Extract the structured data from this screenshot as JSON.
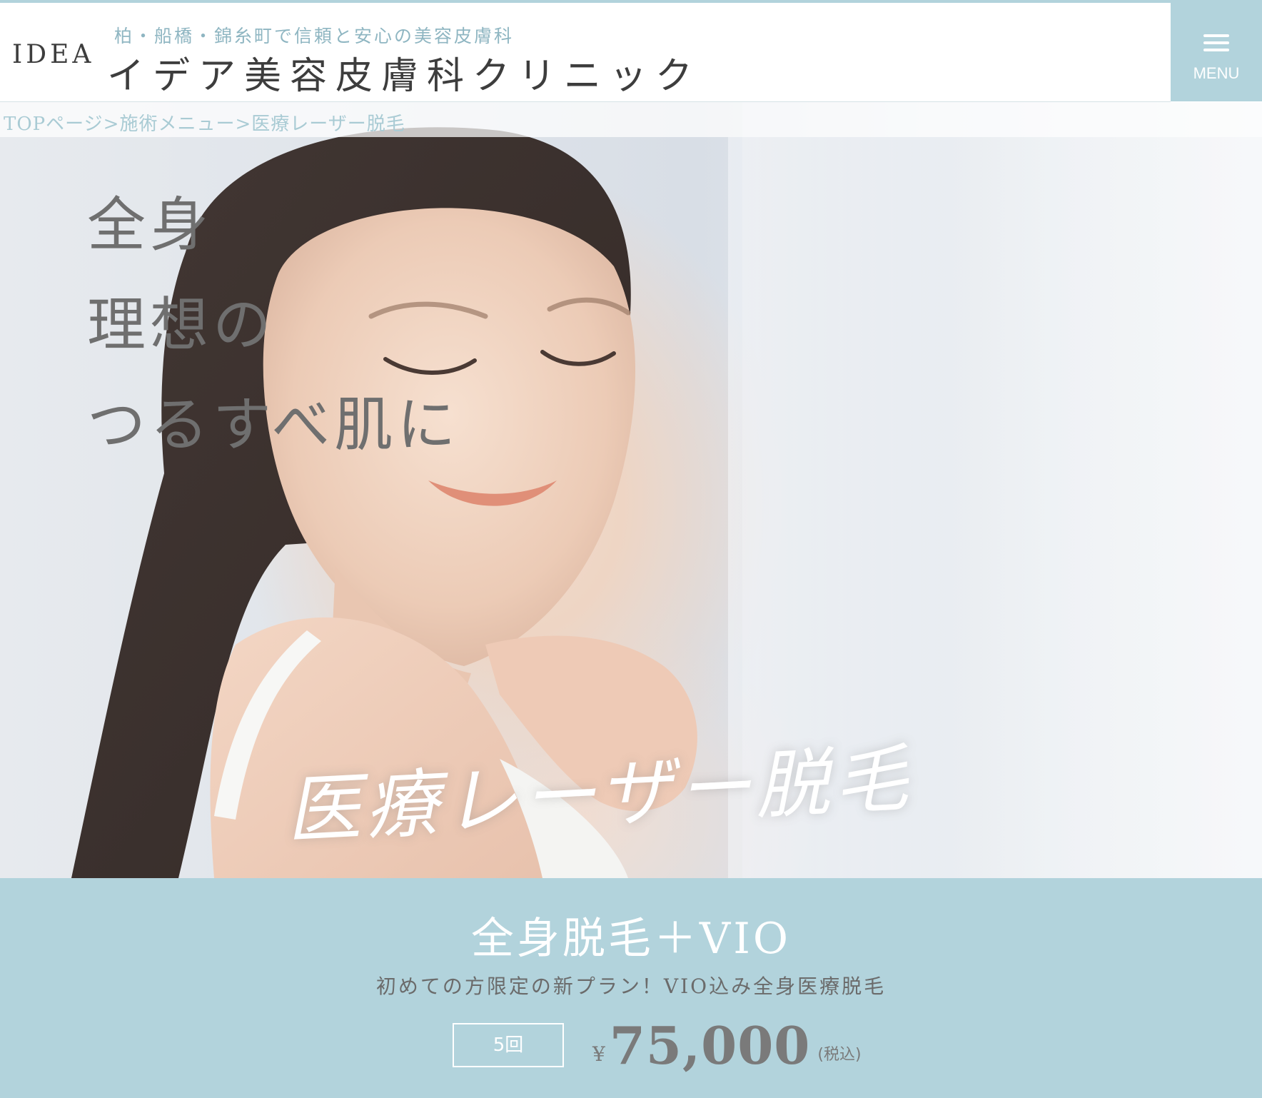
{
  "header": {
    "logo": "IDEA",
    "tagline": "柏・船橋・錦糸町で信頼と安心の美容皮膚科",
    "clinic_name": "イデア美容皮膚科クリニック",
    "menu_label": "MENU"
  },
  "breadcrumb": {
    "items": [
      "TOPページ",
      "施術メニュー",
      "医療レーザー脱毛"
    ],
    "separator": ">"
  },
  "hero": {
    "catch_lines": [
      "全身",
      "理想の",
      "つるすべ肌に"
    ],
    "title": "医療レーザー脱毛"
  },
  "plan": {
    "title": "全身脱毛＋VIO",
    "subtitle": "初めての方限定の新プラン！VIO込み全身医療脱毛",
    "sessions": "5回",
    "currency": "¥",
    "price": "75,000",
    "tax_note": "(税込)"
  },
  "colors": {
    "accent": "#b2d3dc",
    "breadcrumb_text": "#a9cbd4",
    "heading_text": "#3d3d3d",
    "catch_text": "#6f6f6f"
  },
  "icons": {
    "menu": "hamburger-icon"
  }
}
